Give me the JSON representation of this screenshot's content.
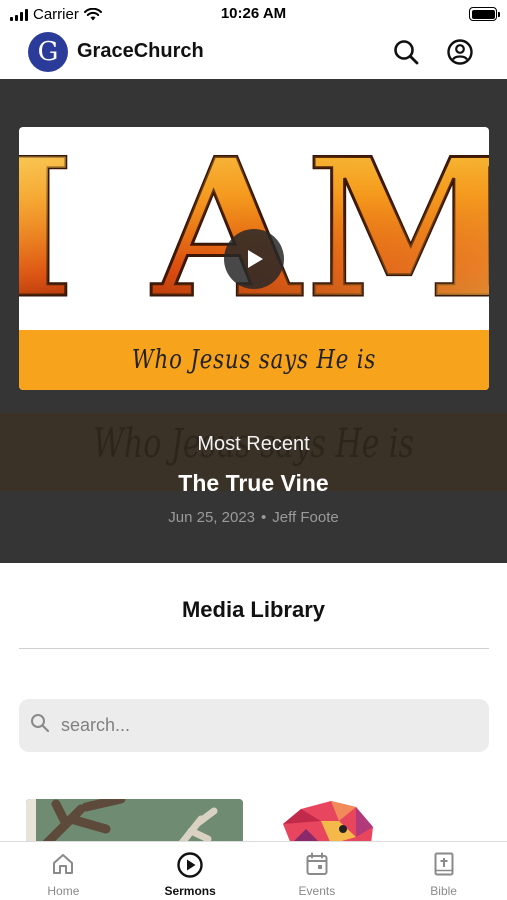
{
  "status_bar": {
    "carrier": "Carrier",
    "time": "10:26 AM"
  },
  "app": {
    "logo_letter": "G",
    "name": "GraceChurch"
  },
  "hero": {
    "artwork_title": "I AM",
    "artwork_subtitle": "Who Jesus says He is",
    "section_label": "Most Recent",
    "sermon_title": "The True Vine",
    "date": "Jun 25, 2023",
    "separator": "•",
    "speaker": "Jeff Foote"
  },
  "library": {
    "title": "Media Library",
    "search_placeholder": "search..."
  },
  "tabs": [
    {
      "label": "Home",
      "icon": "home-icon",
      "active": false
    },
    {
      "label": "Sermons",
      "icon": "play-circle-icon",
      "active": true
    },
    {
      "label": "Events",
      "icon": "calendar-icon",
      "active": false
    },
    {
      "label": "Bible",
      "icon": "bible-icon",
      "active": false
    }
  ],
  "colors": {
    "brand": "#2a3b9a",
    "hero_background": "#353535",
    "accent_band": "#f7a31c",
    "active_tab": "#111111",
    "inactive_tab": "#8a8a8a"
  }
}
